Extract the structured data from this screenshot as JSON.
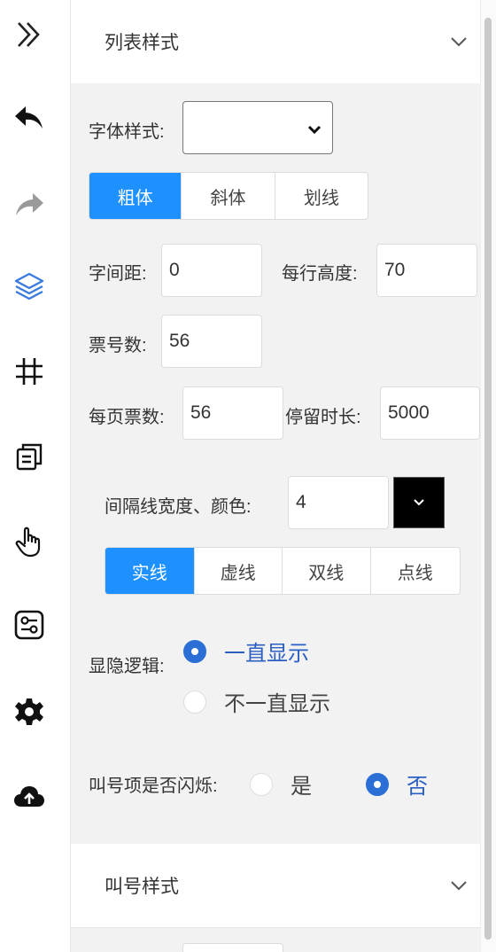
{
  "toolbar": {
    "icons": [
      "chevrons-right-icon",
      "undo-icon",
      "redo-icon",
      "layers-icon",
      "grid-icon",
      "copy-icon",
      "hand-pointer-icon",
      "sliders-icon",
      "gear-icon",
      "cloud-upload-icon"
    ],
    "accent": "#3a7be0"
  },
  "section1": {
    "title": "列表样式",
    "chevron": "chevron-down-icon"
  },
  "font_style": {
    "label": "字体样式:",
    "value": ""
  },
  "text_style_buttons": [
    "粗体",
    "斜体",
    "划线"
  ],
  "letter_spacing": {
    "label": "字间距:",
    "value": "0"
  },
  "row_height": {
    "label": "每行高度:",
    "value": "70"
  },
  "ticket_number_count": {
    "label": "票号数:",
    "value": "56"
  },
  "tickets_per_page": {
    "label": "每页票数:",
    "value": "56"
  },
  "stay_duration": {
    "label": "停留时长:",
    "value": "5000"
  },
  "divider": {
    "label": "间隔线宽度、颜色:",
    "width_value": "4",
    "color": "#000000"
  },
  "line_style_buttons": [
    "实线",
    "虚线",
    "双线",
    "点线"
  ],
  "visibility_logic": {
    "label": "显隐逻辑:",
    "options": [
      "一直显示",
      "不一直显示"
    ],
    "selected": "一直显示"
  },
  "blink": {
    "label": "叫号项是否闪烁:",
    "options": [
      "是",
      "否"
    ],
    "selected": "否"
  },
  "section2": {
    "title": "叫号样式",
    "chevron": "chevron-down-icon"
  },
  "colors": {
    "active": "#1e90ff",
    "radio": "#2b6fd6"
  }
}
